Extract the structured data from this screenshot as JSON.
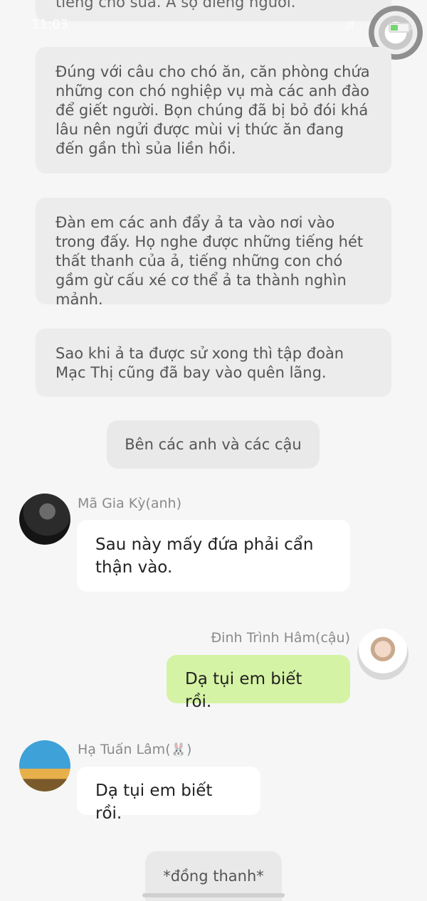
{
  "status": {
    "time": "11:03",
    "signal": "..ıl"
  },
  "narrations": [
    "tiếng chó sủa. A sợ điếng người.",
    "Đúng với câu cho chó ăn, căn phòng chứa những con chó nghiệp vụ mà các anh đào để giết người. Bọn chúng đã bị bỏ đói khá lâu nên ngửi được mùi vị thức ăn đang đến gần thì sủa liền hồi.",
    "Đàn em các anh đẩy ả ta vào nơi vào trong đấy. Họ nghe được những tiếng hét thất thanh của ả, tiếng những con chó gầm gừ cấu xé cơ thể ả ta thành nghìn mảnh.",
    "Sao khi ả ta được sử xong thì tập đoàn Mạc Thị cũng đã bay vào quên lãng."
  ],
  "scene_label": "Bên các anh và các cậu",
  "messages": [
    {
      "sender": "Mã Gia Kỳ(anh)",
      "text": "Sau này mấy đứa phải cẩn thận vào.",
      "side": "left"
    },
    {
      "sender": "Đinh Trình Hâm(cậu)",
      "text": "Dạ tụi em biết rồi.",
      "side": "right"
    },
    {
      "sender_prefix": "Hạ Tuấn Lâm(",
      "sender_emoji": "🐰",
      "sender_suffix": ")",
      "text": "Dạ tụi em biết rồi.",
      "side": "left"
    }
  ],
  "footer_label": "*đồng thanh*",
  "colors": {
    "background": "#f6f6f6",
    "narration_bg": "#ececec",
    "incoming_bubble": "#ffffff",
    "outgoing_bubble": "#d5f3a4"
  },
  "icons": {
    "floating_button": "assistive-touch-icon",
    "battery": "battery-charging-icon"
  }
}
